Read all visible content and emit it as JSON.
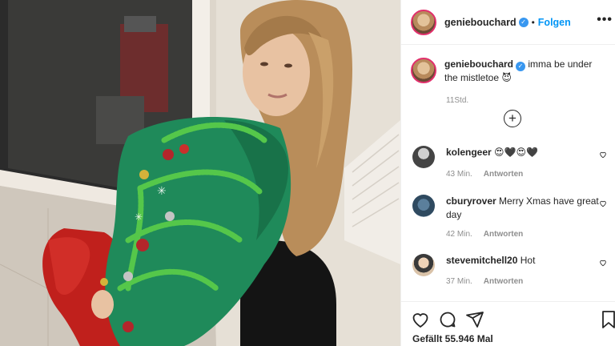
{
  "post": {
    "username": "geniebouchard",
    "follow_label": "Folgen",
    "dot": "•",
    "more_label": "•••",
    "caption_user": "geniebouchard",
    "caption_text": " imma be under the mistletoe 😈",
    "time": "11Std.",
    "load_more": "+"
  },
  "comments": [
    {
      "user": "kolengeer",
      "text": " 😍🖤😍🖤",
      "time": "43 Min.",
      "reply": "Antworten"
    },
    {
      "user": "cburyrover",
      "text": " Merry Xmas have great day",
      "time": "42 Min.",
      "reply": "Antworten"
    },
    {
      "user": "stevemitchell20",
      "text": " Hot",
      "time": "37 Min.",
      "reply": "Antworten"
    }
  ],
  "footer": {
    "likes": "Gefällt 55.946 Mal"
  },
  "icons": {
    "verified": "✓",
    "like": "heart-icon",
    "comment": "comment-icon",
    "share": "share-icon",
    "save": "bookmark-icon"
  },
  "colors": {
    "accent": "#0095f6",
    "verified": "#3897f0",
    "sweater": "#1f8a5a",
    "leggings": "#c0201c"
  }
}
